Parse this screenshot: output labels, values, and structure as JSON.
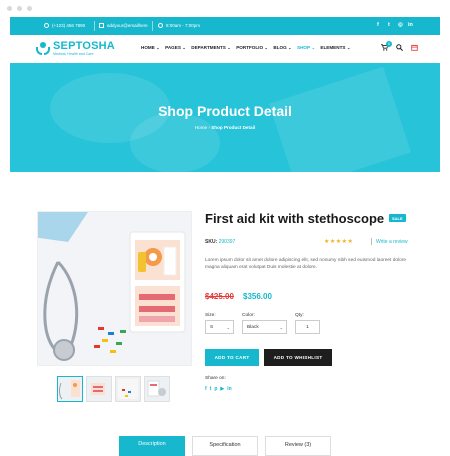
{
  "topbar": {
    "phone": "(+123) 456 7890",
    "email": "addyour@emailhere",
    "hours": "8:00am - 7:00pm",
    "social_icons": [
      "facebook-icon",
      "twitter-icon",
      "instagram-icon",
      "linkedin-icon"
    ]
  },
  "brand": {
    "name": "SEPTOSHA",
    "tagline": "Medical, Health and Care",
    "accent": "#17b8cd"
  },
  "nav": {
    "items": [
      {
        "label": "HOME"
      },
      {
        "label": "PAGES"
      },
      {
        "label": "DEPARTMENTS"
      },
      {
        "label": "PORTFOLIO"
      },
      {
        "label": "BLOG"
      },
      {
        "label": "SHOP",
        "active": true
      },
      {
        "label": "ELEMENTS"
      }
    ],
    "cart_count": "0"
  },
  "hero": {
    "title": "Shop Product Detail",
    "breadcrumb_home": "Home",
    "breadcrumb_sep": "›",
    "breadcrumb_current": "Shop Product Detail"
  },
  "product": {
    "title": "First aid kit with stethoscope",
    "badge": "SALE",
    "sku_label": "SKU:",
    "sku": "290397",
    "rating": 4.5,
    "stars": "★★★★★",
    "review_link": "Write a review",
    "description": "Lorem ipsum dolor sit amet dolore adipiscing elit, sed nonumy nibh sed euismod laoreet dolore magna aliquam erat volutpat Duis molestie at dolore.",
    "old_price": "$425.00",
    "new_price": "$356.00",
    "size_label": "Size:",
    "size_value": "S",
    "color_label": "Color:",
    "color_value": "Black",
    "qty_label": "Qty:",
    "qty_value": "1",
    "add_to_cart": "ADD TO CART",
    "add_to_wishlist": "ADD TO WHISHLIST",
    "share_label": "Share on:",
    "share_icons": [
      "facebook-icon",
      "twitter-icon",
      "pinterest-icon",
      "youtube-icon",
      "linkedin-icon"
    ]
  },
  "tabs": [
    {
      "label": "Description"
    },
    {
      "label": "Specification"
    },
    {
      "label": "Review (3)"
    }
  ]
}
